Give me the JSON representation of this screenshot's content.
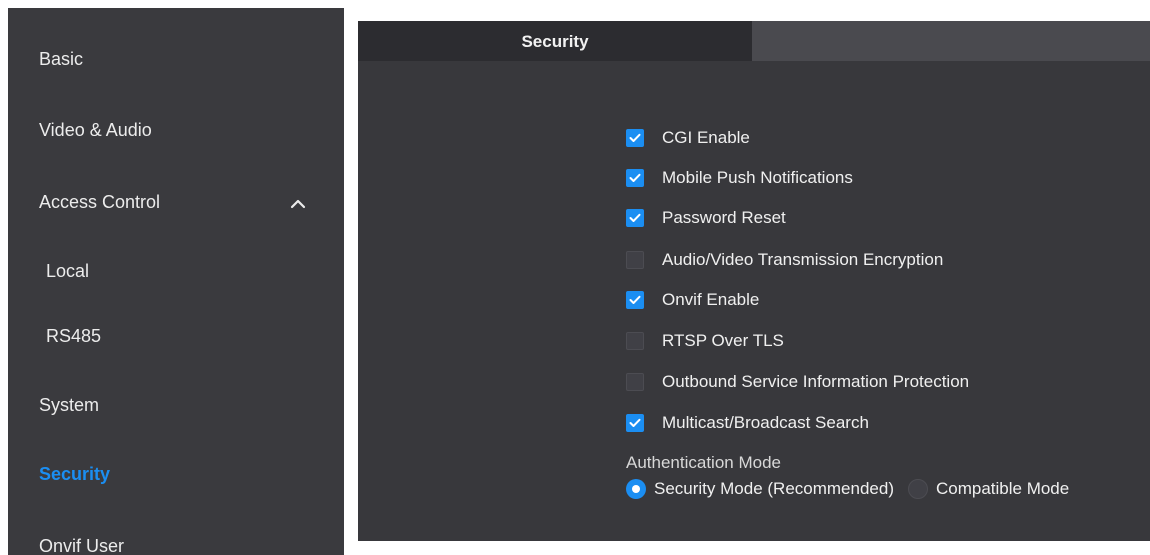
{
  "sidebar": {
    "basic": "Basic",
    "video_audio": "Video & Audio",
    "access_control": "Access Control",
    "access_control_expanded": true,
    "local": "Local",
    "rs485": "RS485",
    "system": "System",
    "security": "Security",
    "onvif_user": "Onvif User",
    "active_item": "Security"
  },
  "main": {
    "tab_label": "Security",
    "options": [
      {
        "label": "CGI Enable",
        "checked": true
      },
      {
        "label": "Mobile Push Notifications",
        "checked": true
      },
      {
        "label": "Password Reset",
        "checked": true
      },
      {
        "label": "Audio/Video Transmission Encryption",
        "checked": false
      },
      {
        "label": "Onvif Enable",
        "checked": true
      },
      {
        "label": "RTSP Over TLS",
        "checked": false
      },
      {
        "label": "Outbound Service Information Protection",
        "checked": false
      },
      {
        "label": "Multicast/Broadcast Search",
        "checked": true
      }
    ],
    "auth": {
      "title": "Authentication Mode",
      "modes": [
        {
          "label": "Security Mode (Recommended)",
          "selected": true
        },
        {
          "label": "Compatible Mode",
          "selected": false
        }
      ]
    }
  },
  "colors": {
    "accent": "#1b8ef2",
    "panel": "#38383c",
    "sidebar": "#3a3a3e"
  },
  "icons": {
    "checkbox_mark": "check-icon",
    "access_control_toggle": "chevron-up-icon"
  }
}
